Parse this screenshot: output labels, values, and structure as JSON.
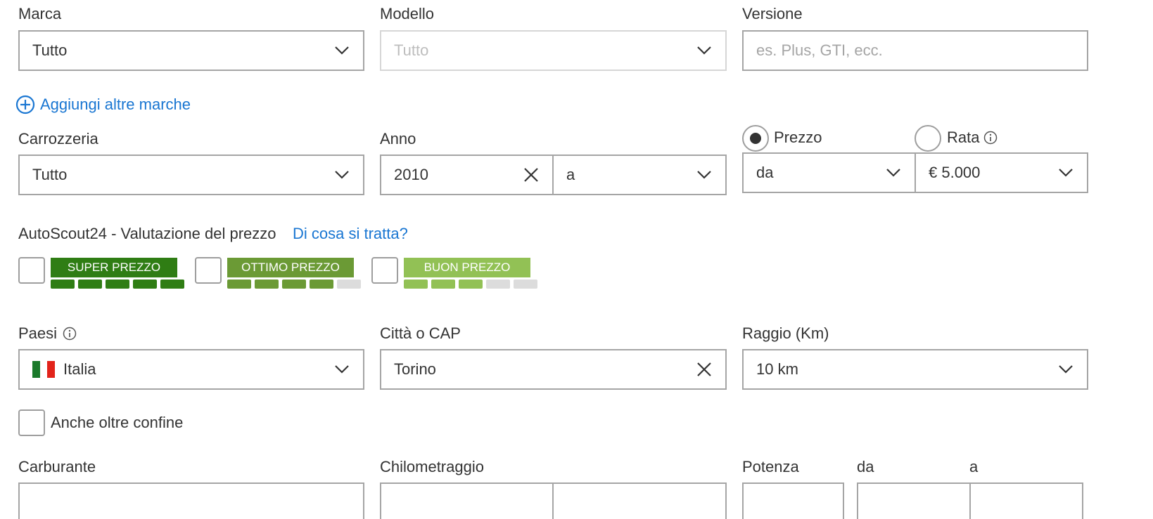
{
  "make": {
    "label": "Marca",
    "value": "Tutto"
  },
  "model": {
    "label": "Modello",
    "placeholder": "Tutto"
  },
  "version": {
    "label": "Versione",
    "placeholder": "es. Plus, GTI, ecc."
  },
  "add_makes_label": "Aggiungi altre marche",
  "body": {
    "label": "Carrozzeria",
    "value": "Tutto"
  },
  "year": {
    "label": "Anno",
    "from_value": "2010",
    "to_value": "a"
  },
  "price": {
    "mode_price_label": "Prezzo",
    "mode_rate_label": "Rata",
    "selected_mode": "Prezzo",
    "from_value": "da",
    "to_value": "€ 5.000"
  },
  "rating": {
    "title": "AutoScout24 - Valutazione del prezzo",
    "help_link": "Di cosa si tratta?",
    "options": [
      {
        "label": "SUPER PREZZO",
        "color": "#2f7d14",
        "level": 5
      },
      {
        "label": "OTTIMO PREZZO",
        "color": "#6b9a35",
        "level": 4
      },
      {
        "label": "BUON PREZZO",
        "color": "#92c155",
        "level": 3
      }
    ],
    "inactive_bar_color": "#dcdcdc"
  },
  "country": {
    "label": "Paesi",
    "value": "Italia"
  },
  "city": {
    "label": "Città o CAP",
    "value": "Torino"
  },
  "radius": {
    "label": "Raggio (Km)",
    "value": "10 km"
  },
  "cross_border_label": "Anche oltre confine",
  "fuel": {
    "label": "Carburante"
  },
  "mileage": {
    "label": "Chilometraggio"
  },
  "power": {
    "label": "Potenza",
    "from_label": "da",
    "to_label": "a"
  },
  "colors": {
    "accent": "#1976d2",
    "border": "#a5a5a5",
    "text": "#333333"
  },
  "icons": [
    "chevron-down-icon",
    "close-icon",
    "plus-circle-icon",
    "info-icon",
    "italy-flag-icon"
  ]
}
